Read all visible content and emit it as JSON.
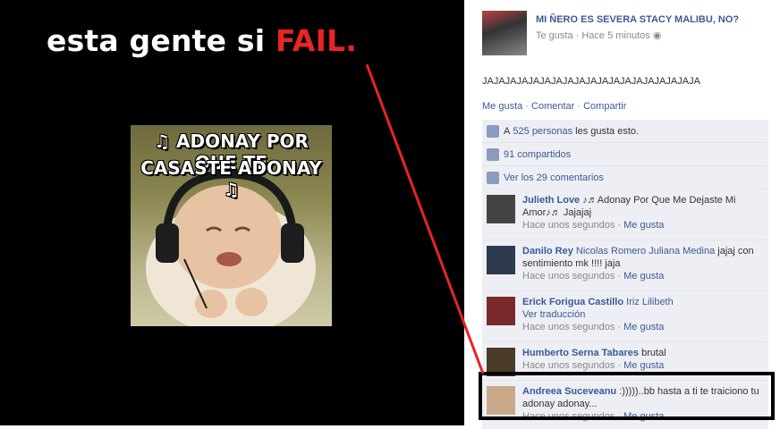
{
  "photo": {
    "caption_prefix": "esta gente si ",
    "caption_fail": "FAIL.",
    "meme_line1": "♫ ADONAY POR QUE TE",
    "meme_line2": "CASASTE ADONAY ♫"
  },
  "post": {
    "title": "MI ÑERO ES SEVERA STACY MALIBU, NO?",
    "meta": "Te gusta · Hace 5 minutos",
    "text": "JAJAJAJAJAJAJAJAJAJAJAJAJAJAJAJAJAJAJA",
    "actions": {
      "like": "Me gusta",
      "comment": "Comentar",
      "share": "Compartir",
      "sep": " · "
    }
  },
  "ufi": {
    "likes_prefix": "A ",
    "likes_link": "525 personas",
    "likes_suffix": " les gusta esto.",
    "shares": "91 compartidos",
    "view_comments": "Ver los 29 comentarios"
  },
  "comments": [
    {
      "name": "Julieth Love",
      "text": "♪♬Adonay Por Que Me Dejaste Mi Amor♪♬ Jajajaj",
      "time": "Hace unos segundos",
      "like": "Me gusta",
      "extra": ""
    },
    {
      "name": "Danilo Rey",
      "text": "jajaj con sentimiento mk !!!! jaja",
      "tags": "Nicolas Romero Juliana Medina",
      "time": "Hace unos segundos",
      "like": "Me gusta",
      "extra": ""
    },
    {
      "name": "Erick Forigua Castillo",
      "tags": "Iriz Lilibeth",
      "text": "",
      "extra": "Ver traducción",
      "time": "Hace unos segundos",
      "like": "Me gusta"
    },
    {
      "name": "Humberto Serna Tabares",
      "text": "brutal",
      "time": "Hace unos segundos",
      "like": "Me gusta",
      "extra": ""
    },
    {
      "name": "Andreea Suceveanu",
      "text": ":)))))..bb hasta a ti te traiciono tu adonay adonay...",
      "time": "Hace unos segundos",
      "like": "Me gusta",
      "extra": ""
    }
  ],
  "colors": {
    "link": "#3b5998",
    "fail": "#e82424",
    "arrow": "#e82424"
  },
  "icons": [
    "thumbs-up-icon",
    "share-icon",
    "comments-icon",
    "globe-icon"
  ]
}
